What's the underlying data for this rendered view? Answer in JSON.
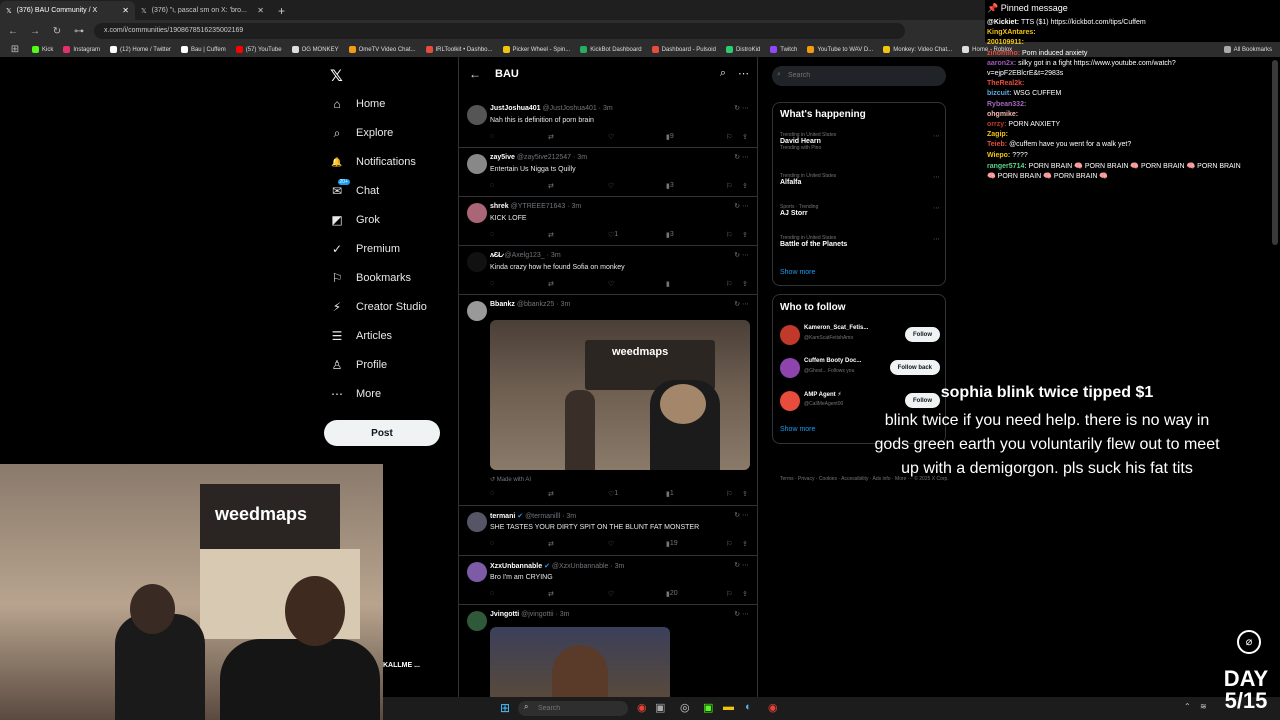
{
  "browser": {
    "tabs": [
      {
        "title": "(376) BAU Community / X",
        "active": true
      },
      {
        "title": "(376) \"ι, pascal sm on X: 'bro...",
        "active": false
      }
    ],
    "url": "x.com/i/communities/1908678516235002169",
    "bookmarks": [
      "Kick",
      "Instagram",
      "(12) Home / Twitter",
      "Bau | Cuffem",
      "(57) YouTube",
      "OG MONKEY",
      "OmeTV Video Chat...",
      "IRLToolkit • Dashbo...",
      "Picker Wheel - Spin...",
      "KickBot Dashboard",
      "Dashboard - Pulsoid",
      "DistroKid",
      "Twitch",
      "YouTube to WAV D...",
      "Monkey: Video Chat...",
      "Home - Roblox"
    ],
    "all_bookmarks": "All Bookmarks"
  },
  "nav": {
    "items": [
      {
        "label": "Home",
        "icon": "home-icon",
        "glyph": "⌂"
      },
      {
        "label": "Explore",
        "icon": "search-icon",
        "glyph": "⌕"
      },
      {
        "label": "Notifications",
        "icon": "bell-icon",
        "glyph": "🔔"
      },
      {
        "label": "Chat",
        "icon": "chat-icon",
        "glyph": "✉"
      },
      {
        "label": "Grok",
        "icon": "grok-icon",
        "glyph": "◩"
      },
      {
        "label": "Premium",
        "icon": "premium-icon",
        "glyph": "✓"
      },
      {
        "label": "Bookmarks",
        "icon": "bookmark-icon",
        "glyph": "⚐"
      },
      {
        "label": "Creator Studio",
        "icon": "creator-icon",
        "glyph": "⚡"
      },
      {
        "label": "Articles",
        "icon": "articles-icon",
        "glyph": "☰"
      },
      {
        "label": "Profile",
        "icon": "profile-icon",
        "glyph": "♙"
      },
      {
        "label": "More",
        "icon": "more-icon",
        "glyph": "⋯"
      }
    ],
    "chat_badge": "20+",
    "post": "Post"
  },
  "feed": {
    "title": "BAU",
    "tweets": [
      {
        "name": "JustJoshua401",
        "handle": "@JustJoshua401 · 3m",
        "text": "Nah this is definition of porn brain",
        "likes": "",
        "views": "9"
      },
      {
        "name": "zay5ive",
        "handle": "@zay5ive212547 · 3m",
        "text": "Entertain Us Nigga ts Quilly",
        "likes": "",
        "views": "3"
      },
      {
        "name": "shrek",
        "handle": "@YTREEE71643 · 3m",
        "text": "KICK LOFE",
        "likes": "1",
        "views": "3"
      },
      {
        "name": "ʌ̷Ɛ̷L̷",
        "handle": "@Axelg123_ · 3m",
        "text": "Kinda crazy how he found Sofia on monkey",
        "likes": "",
        "views": ""
      },
      {
        "name": "Bbankz",
        "handle": "@bbankz25 · 3m",
        "text": "",
        "made_with": "Made with AI",
        "likes": "1",
        "views": "1"
      },
      {
        "name": "termani",
        "handle": "@termanilll · 3m",
        "text": "SHE TASTES YOUR DIRTY SPIT ON THE BLUNT FAT MONSTER",
        "likes": "",
        "views": "19"
      },
      {
        "name": "XzxUnbannable",
        "handle": "@XzxUnbannable · 3m",
        "text": "Bro I'm am CRYING",
        "likes": "",
        "views": "20"
      },
      {
        "name": "Jvingotti",
        "handle": "@jvingottii · 3m",
        "text": "",
        "likes": "",
        "views": ""
      }
    ],
    "media_caption": "weedmaps"
  },
  "sidebar": {
    "search_placeholder": "Search",
    "happening_title": "What's happening",
    "trends": [
      {
        "meta": "Trending in United States",
        "name": "David Hearn",
        "sub": "Trending with Pino"
      },
      {
        "meta": "Trending in United States",
        "name": "Alfalfa",
        "sub": ""
      },
      {
        "meta": "Sports · Trending",
        "name": "AJ Storr",
        "sub": ""
      },
      {
        "meta": "Trending in United States",
        "name": "Battle of the Planets",
        "sub": ""
      }
    ],
    "show_more": "Show more",
    "wtf_title": "Who to follow",
    "who_to_follow": [
      {
        "name": "Kameron_Scat_Fetis...",
        "handle": "@KamScatFetishAmo",
        "button": "Follow",
        "color": "#c0392b"
      },
      {
        "name": "Cuffem Booty Doc...",
        "handle": "@Ghost... Follows you",
        "button": "Follow back",
        "color": "#8e44ad"
      },
      {
        "name": "AMP Agent ⚡",
        "handle": "@CallMeAgent00",
        "button": "Follow",
        "color": "#e74c3c"
      }
    ],
    "footer": "Terms · Privacy · Cookies · Accessibility · Ads info · More ··· © 2025 X Corp."
  },
  "chat": {
    "pinned": "Pinned message",
    "lines": [
      {
        "user": "@Kickiet:",
        "msg": "TTS ($1) https://kickbot.com/tips/Cuffem",
        "color": "#ffffff"
      },
      {
        "user": "KingXAntares:",
        "msg": "",
        "color": "#f1c40f"
      },
      {
        "user": "200109911:",
        "msg": "",
        "color": "#f1c40f"
      },
      {
        "user": "zinomino:",
        "msg": "Porn induced anxiety",
        "color": "#e74c3c"
      },
      {
        "user": "aaron2x:",
        "msg": "silky got in a fight https://www.youtube.com/watch?",
        "color": "#9b59b6"
      },
      {
        "user": "",
        "msg": "v=ejpF2EBlcrE&t=2983s",
        "color": "#ffffff"
      },
      {
        "user": "TheReal2k:",
        "msg": "",
        "color": "#e74c3c"
      },
      {
        "user": "bizcuit:",
        "msg": "WSG CUFFEM",
        "color": "#5dade2"
      },
      {
        "user": "Rybean332:",
        "msg": "",
        "color": "#a569bd"
      },
      {
        "user": "ohgmike:",
        "msg": "",
        "color": "#f5b7b1"
      },
      {
        "user": "orrzy:",
        "msg": "PORN ANXIETY",
        "color": "#c0392b"
      },
      {
        "user": "Zagip:",
        "msg": "",
        "color": "#f1c40f"
      },
      {
        "user": "Teieb:",
        "msg": "@cuffem have you went for a walk yet?",
        "color": "#e74c3c"
      },
      {
        "user": "Wiepo:",
        "msg": "????",
        "color": "#f1c40f"
      },
      {
        "user": "ranger5714:",
        "msg": "PORN BRAIN 🧠 PORN BRAIN 🧠 PORN BRAIN 🧠 PORN BRAIN",
        "color": "#58d68d"
      },
      {
        "user": "",
        "msg": "🧠 PORN BRAIN 🧠 PORN BRAIN 🧠",
        "color": "#ffffff"
      }
    ]
  },
  "donation": {
    "title": "sophia blink twice tipped $1",
    "message": "blink twice if you need help. there is no way in gods green earth you voluntarily flew out to meet up with a demigorgon. pls suck his fat tits"
  },
  "webcam": {
    "sign": "weedmaps",
    "name_tag": "KALLME ..."
  },
  "taskbar": {
    "search": "Search"
  },
  "overlay": {
    "day": "DAY 5/15"
  }
}
